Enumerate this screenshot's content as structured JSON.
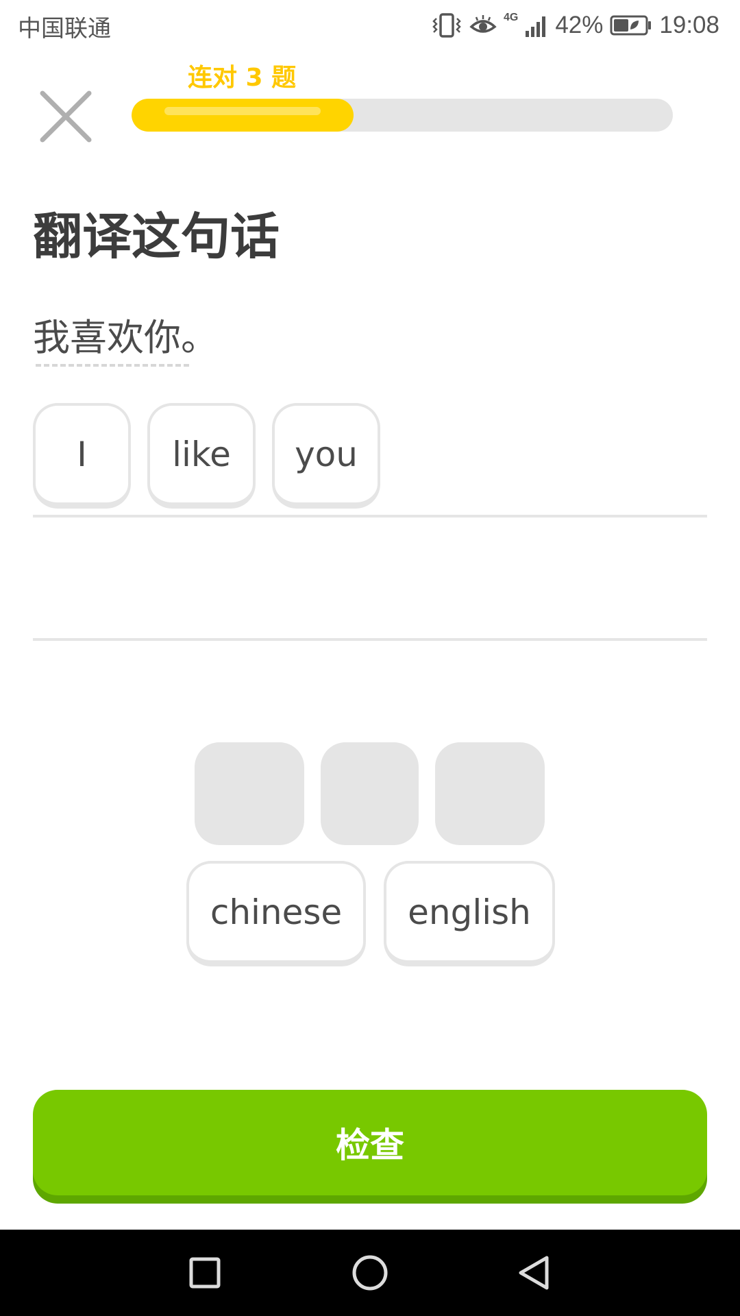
{
  "status_bar": {
    "carrier": "中国联通",
    "network": "4G",
    "battery_percent": "42%",
    "time": "19:08",
    "icons": [
      "vibrate-icon",
      "eye-comfort-icon",
      "signal-icon",
      "battery-icon"
    ]
  },
  "header": {
    "close_icon": "close-icon",
    "streak_label": "连对 3 题",
    "progress": 0.41
  },
  "prompt": {
    "title": "翻译这句话",
    "sentence": "我喜欢你。"
  },
  "answer": {
    "tiles": [
      "I",
      "like",
      "you"
    ]
  },
  "word_bank": {
    "used_placeholders": 3,
    "tiles": [
      "chinese",
      "english"
    ]
  },
  "check_button": {
    "label": "检查"
  },
  "nav_bar": {
    "icons": [
      "recent-apps-icon",
      "home-icon",
      "back-icon"
    ]
  },
  "colors": {
    "accent_yellow": "#ffc800",
    "progress_fill": "#ffd400",
    "progress_track": "#e5e5e5",
    "check_button": "#78c800",
    "check_button_shadow": "#5ea700",
    "tile_border": "#e5e5e5",
    "text": "#4b4b4b"
  }
}
